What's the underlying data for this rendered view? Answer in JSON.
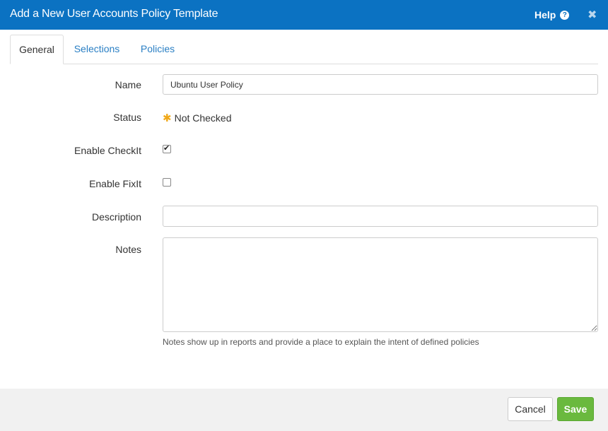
{
  "dialog": {
    "title": "Add a New User Accounts Policy Template",
    "help_label": "Help",
    "help_icon": "question-circle-icon",
    "close_icon": "close-icon",
    "header_color": "#0b72c2"
  },
  "tabs": [
    {
      "label": "General",
      "active": true
    },
    {
      "label": "Selections",
      "active": false
    },
    {
      "label": "Policies",
      "active": false
    }
  ],
  "form": {
    "name": {
      "label": "Name",
      "value": "Ubuntu User Policy"
    },
    "status": {
      "label": "Status",
      "value": "Not Checked",
      "icon": "asterisk-icon"
    },
    "enable_checkit": {
      "label": "Enable CheckIt",
      "checked": true
    },
    "enable_fixit": {
      "label": "Enable FixIt",
      "checked": false
    },
    "description": {
      "label": "Description",
      "value": ""
    },
    "notes": {
      "label": "Notes",
      "value": "",
      "hint": "Notes show up in reports and provide a place to explain the intent of defined policies"
    }
  },
  "footer": {
    "cancel_label": "Cancel",
    "save_label": "Save",
    "save_color": "#6ab93e"
  }
}
